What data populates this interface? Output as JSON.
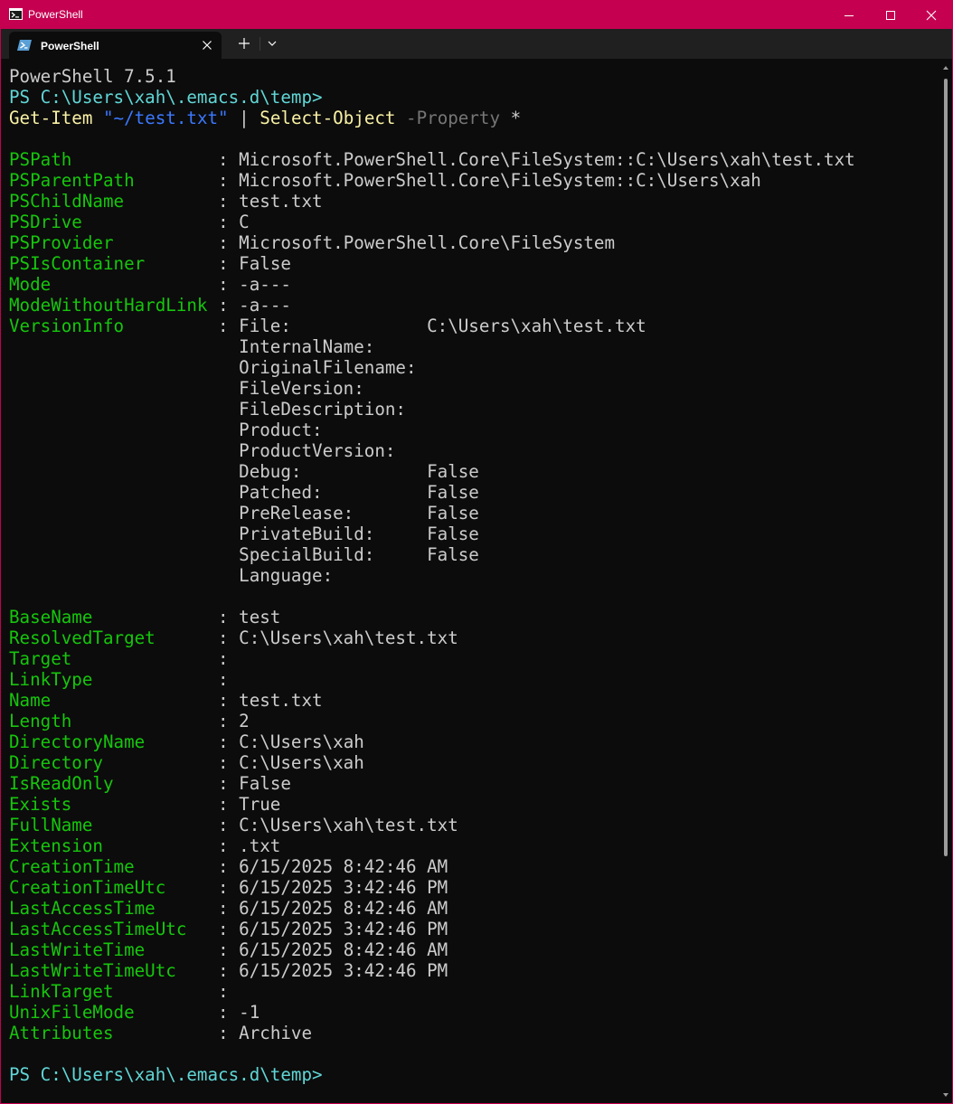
{
  "window": {
    "title": "PowerShell"
  },
  "tabs": [
    {
      "label": "PowerShell"
    }
  ],
  "icons": {
    "app": "powershell-icon",
    "tab": "powershell-icon",
    "close": "close-icon",
    "new_tab": "plus-icon",
    "dropdown": "chevron-down-icon",
    "minimize": "minimize-icon",
    "maximize": "maximize-icon"
  },
  "colors": {
    "titlebar": "#c50051",
    "terminal_bg": "#0c0c0c",
    "property_name": "#16c60c",
    "prompt": "#61d6d6",
    "command": "#f9f1a5",
    "string": "#3b78ff",
    "parameter": "#767676",
    "text": "#cccccc"
  },
  "terminal": {
    "version_line": "PowerShell 7.5.1",
    "prompt1": "PS C:\\Users\\xah\\.emacs.d\\temp>",
    "command": {
      "cmdlet1": "Get-Item",
      "arg": "\"~/test.txt\"",
      "pipe": "|",
      "cmdlet2": "Select-Object",
      "param": "-Property",
      "star": "*"
    },
    "props1": [
      {
        "name": "PSPath",
        "value": "Microsoft.PowerShell.Core\\FileSystem::C:\\Users\\xah\\test.txt"
      },
      {
        "name": "PSParentPath",
        "value": "Microsoft.PowerShell.Core\\FileSystem::C:\\Users\\xah"
      },
      {
        "name": "PSChildName",
        "value": "test.txt"
      },
      {
        "name": "PSDrive",
        "value": "C"
      },
      {
        "name": "PSProvider",
        "value": "Microsoft.PowerShell.Core\\FileSystem"
      },
      {
        "name": "PSIsContainer",
        "value": "False"
      },
      {
        "name": "Mode",
        "value": "-a---"
      },
      {
        "name": "ModeWithoutHardLink",
        "value": "-a---"
      },
      {
        "name": "VersionInfo",
        "value": "File:             C:\\Users\\xah\\test.txt"
      }
    ],
    "version_info": [
      "InternalName:",
      "OriginalFilename:",
      "FileVersion:",
      "FileDescription:",
      "Product:",
      "ProductVersion:",
      "Debug:            False",
      "Patched:          False",
      "PreRelease:       False",
      "PrivateBuild:     False",
      "SpecialBuild:     False",
      "Language:"
    ],
    "props2": [
      {
        "name": "BaseName",
        "value": "test"
      },
      {
        "name": "ResolvedTarget",
        "value": "C:\\Users\\xah\\test.txt"
      },
      {
        "name": "Target",
        "value": ""
      },
      {
        "name": "LinkType",
        "value": ""
      },
      {
        "name": "Name",
        "value": "test.txt"
      },
      {
        "name": "Length",
        "value": "2"
      },
      {
        "name": "DirectoryName",
        "value": "C:\\Users\\xah"
      },
      {
        "name": "Directory",
        "value": "C:\\Users\\xah"
      },
      {
        "name": "IsReadOnly",
        "value": "False"
      },
      {
        "name": "Exists",
        "value": "True"
      },
      {
        "name": "FullName",
        "value": "C:\\Users\\xah\\test.txt"
      },
      {
        "name": "Extension",
        "value": ".txt"
      },
      {
        "name": "CreationTime",
        "value": "6/15/2025 8:42:46 AM"
      },
      {
        "name": "CreationTimeUtc",
        "value": "6/15/2025 3:42:46 PM"
      },
      {
        "name": "LastAccessTime",
        "value": "6/15/2025 8:42:46 AM"
      },
      {
        "name": "LastAccessTimeUtc",
        "value": "6/15/2025 3:42:46 PM"
      },
      {
        "name": "LastWriteTime",
        "value": "6/15/2025 8:42:46 AM"
      },
      {
        "name": "LastWriteTimeUtc",
        "value": "6/15/2025 3:42:46 PM"
      },
      {
        "name": "LinkTarget",
        "value": ""
      },
      {
        "name": "UnixFileMode",
        "value": "-1"
      },
      {
        "name": "Attributes",
        "value": "Archive"
      }
    ],
    "prompt2": "PS C:\\Users\\xah\\.emacs.d\\temp>"
  }
}
